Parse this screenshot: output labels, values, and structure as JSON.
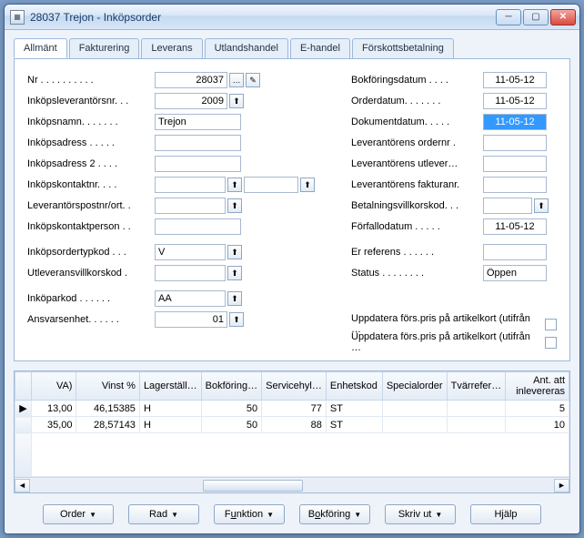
{
  "window": {
    "title": "28037 Trejon - Inköpsorder",
    "min_icon": "─",
    "max_icon": "▢",
    "close_icon": "✕"
  },
  "tabs": [
    "Allmänt",
    "Fakturering",
    "Leverans",
    "Utlandshandel",
    "E-handel",
    "Förskottsbetalning"
  ],
  "left": {
    "nr_label": "Nr  . . . . . . . . . .",
    "nr_value": "28037",
    "nr_ellipsis": "…",
    "inkopslev_label": "Inköpsleverantörsnr. . .",
    "inkopslev_value": "2009",
    "inkopsnamn_label": "Inköpsnamn. . . . . . .",
    "inkopsnamn_value": "Trejon",
    "inkopsadress_label": "Inköpsadress  . . . . .",
    "inkopsadress_value": "",
    "inkopsadress2_label": "Inköpsadress 2  . . . .",
    "inkopsadress2_value": "",
    "inkopskontaktnr_label": "Inköpskontaktnr.  . . .",
    "inkopskontaktnr_value": "",
    "inkopskontaktnr2_value": "",
    "levpostort_label": "Leverantörspostnr/ort. .",
    "levpostort_value": "",
    "inkopskontaktperson_label": "Inköpskontaktperson  . .",
    "inkopskontaktperson_value": "",
    "ordertyp_label": "Inköpsordertypkod . . .",
    "ordertyp_value": "V",
    "utlevvillkor_label": "Utleveransvillkorskod  .",
    "utlevvillkor_value": "",
    "inkoparkod_label": "Inköparkod . . . . . .",
    "inkoparkod_value": "AA",
    "ansvarsenhet_label": "Ansvarsenhet. . . . . .",
    "ansvarsenhet_value": "01"
  },
  "right": {
    "bokfdatum_label": "Bokföringsdatum  . . . .",
    "bokfdatum_value": "11-05-12",
    "orderdatum_label": "Orderdatum. . . . . . .",
    "orderdatum_value": "11-05-12",
    "dokdatum_label": "Dokumentdatum. . . . .",
    "dokdatum_value": "11-05-12",
    "levordnr_label": "Leverantörens ordernr  .",
    "levordnr_value": "",
    "levutlev_label": "Leverantörens utlever…",
    "levutlev_value": "",
    "levfaktnr_label": "Leverantörens fakturanr.",
    "levfaktnr_value": "",
    "betvillkor_label": "Betalningsvillkorskod. . .",
    "betvillkor_value": "",
    "forfallo_label": "Förfallodatum  . . . . .",
    "forfallo_value": "11-05-12",
    "erref_label": "Er referens  . . . . . .",
    "erref_value": "",
    "status_label": "Status  . . . . . . . .",
    "status_value": "Öppen",
    "upd1": "Uppdatera förs.pris på artikelkort  (utifrån …",
    "upd2": "Uppdatera förs.pris på artikelkort  (utifrån …"
  },
  "grid": {
    "headers": [
      "VA)",
      "Vinst %",
      "Lagerställ…",
      "Bokföring…",
      "Servicehyl…",
      "Enhetskod",
      "Specialorder",
      "Tvärrefer…",
      "Ant. att inlevereras"
    ],
    "rows": [
      {
        "va": "13,00",
        "vinst": "46,15385",
        "lager": "H",
        "bokf": "50",
        "service": "77",
        "enhet": "ST",
        "special": "",
        "tvarr": "",
        "ant": "5"
      },
      {
        "va": "35,00",
        "vinst": "28,57143",
        "lager": "H",
        "bokf": "50",
        "service": "88",
        "enhet": "ST",
        "special": "",
        "tvarr": "",
        "ant": "10"
      }
    ],
    "row_marker": "▶"
  },
  "buttons": {
    "order": "Order",
    "rad": "Rad",
    "funktion": "Funktion",
    "bokforing": "Bokföring",
    "skrivut": "Skriv ut",
    "hjalp": "Hjälp"
  },
  "icons": {
    "lookup": "⬆",
    "pencil": "✎",
    "dropdown": "▼",
    "left": "◄",
    "right": "►"
  }
}
